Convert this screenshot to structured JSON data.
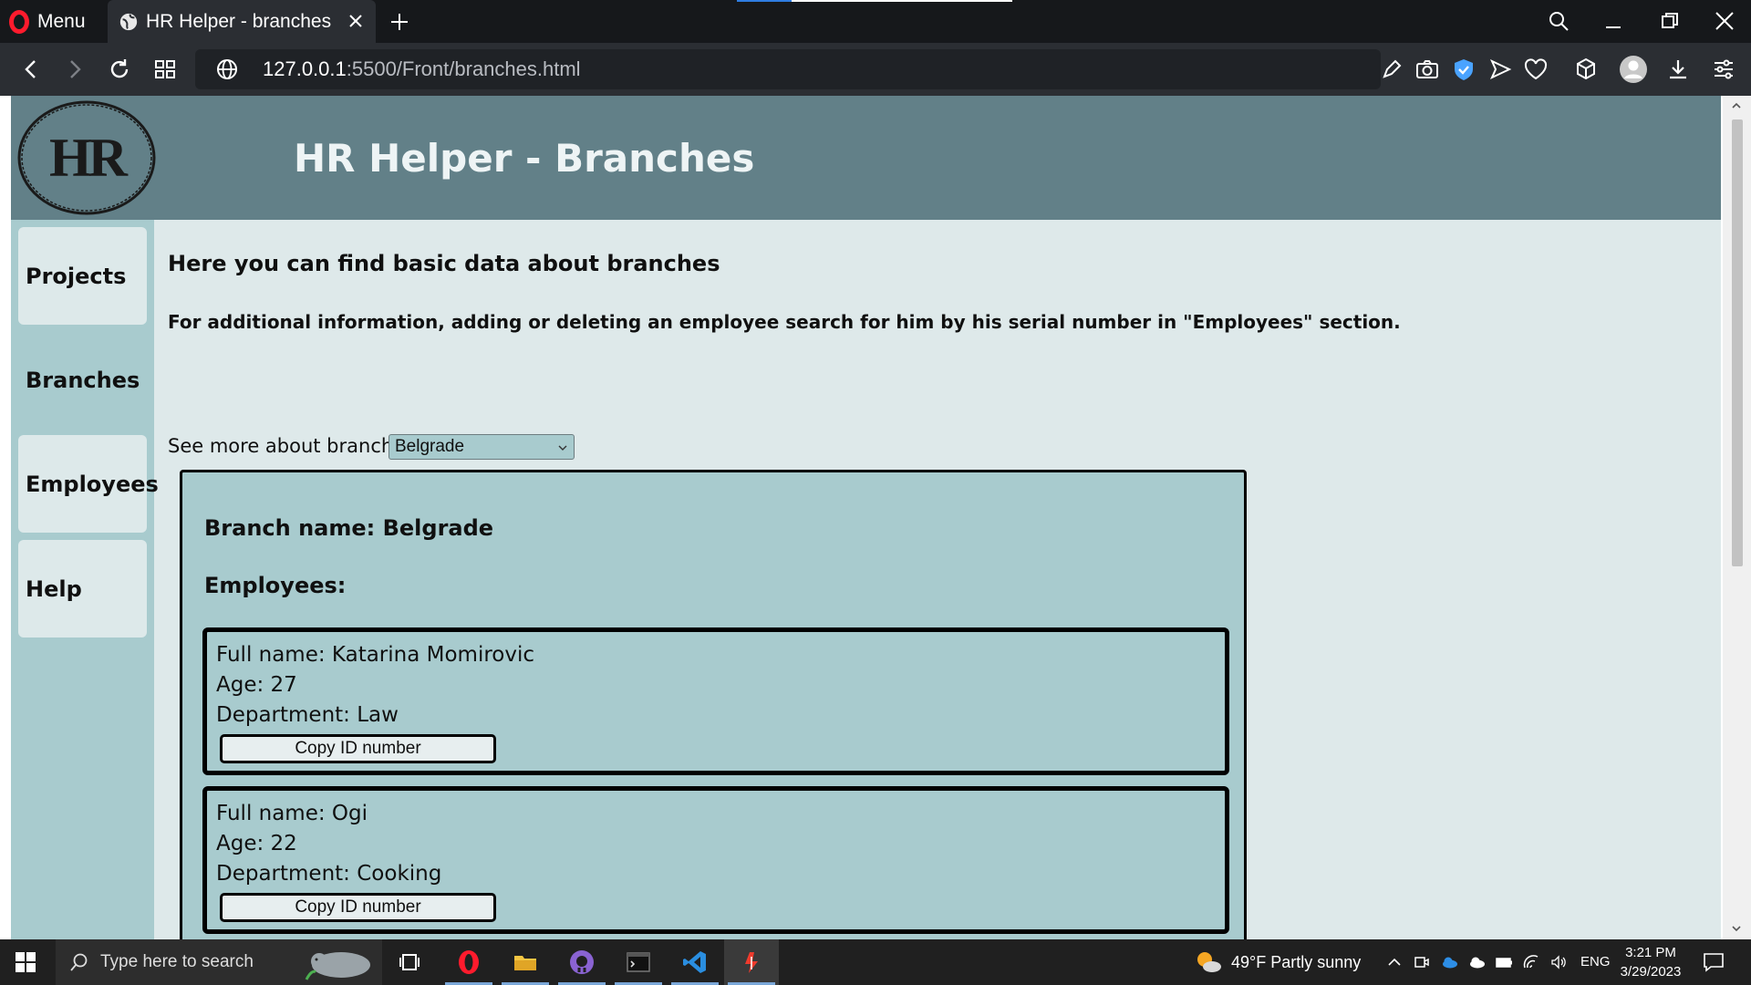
{
  "browser": {
    "menu_label": "Menu",
    "tab_title": "HR Helper - branches",
    "url_host": "127.0.0.1",
    "url_path": ":5500/Front/branches.html"
  },
  "page": {
    "logo_text": "HR",
    "title": "HR Helper - Branches",
    "sidebar": [
      {
        "label": "Projects"
      },
      {
        "label": "Branches"
      },
      {
        "label": "Employees"
      },
      {
        "label": "Help"
      }
    ],
    "intro_heading": "Here you can find basic data about branches",
    "intro_note": "For additional information, adding or deleting an employee search for him by his serial number in \"Employees\" section.",
    "branch_select_label": "See more about branch:",
    "branch_select_value": "Belgrade",
    "branch": {
      "name_line": "Branch name: Belgrade",
      "employees_heading": "Employees:",
      "employees": [
        {
          "full_name": "Full name: Katarina Momirovic",
          "age": "Age: 27",
          "department": "Department: Law",
          "button": "Copy ID number"
        },
        {
          "full_name": "Full name: Ogi",
          "age": "Age: 22",
          "department": "Department: Cooking",
          "button": "Copy ID number"
        }
      ]
    }
  },
  "taskbar": {
    "search_placeholder": "Type here to search",
    "weather": "49°F  Partly sunny",
    "language": "ENG",
    "time": "3:21 PM",
    "date": "3/29/2023"
  },
  "colors": {
    "header": "#628088",
    "sidebar": "#a8cbce",
    "page_bg": "#dee9ea",
    "opera_red": "#ff1b2d"
  }
}
